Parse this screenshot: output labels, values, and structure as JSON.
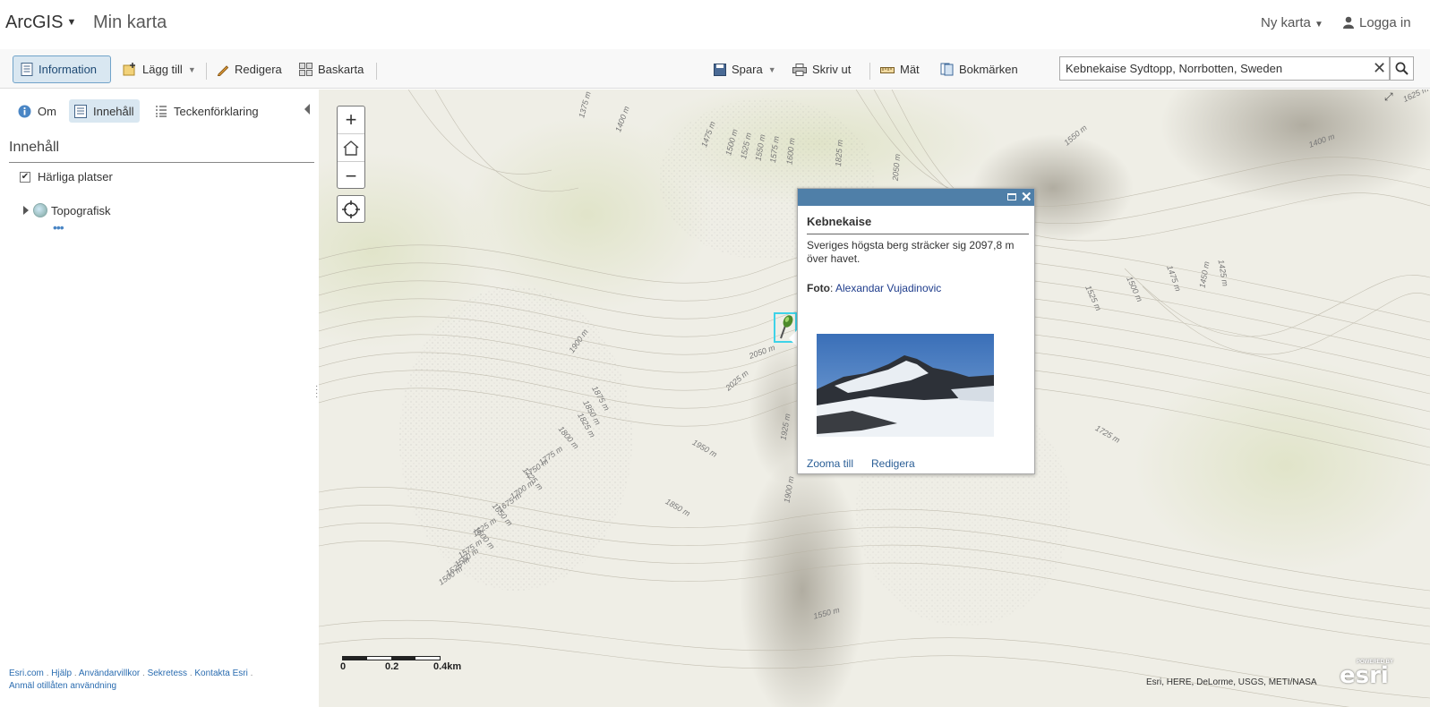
{
  "header": {
    "brand": "ArcGIS",
    "map_title": "Min karta",
    "new_map": "Ny karta",
    "login": "Logga in"
  },
  "toolbar": {
    "info": "Information",
    "add": "Lägg till",
    "edit": "Redigera",
    "basemap": "Baskarta",
    "save": "Spara",
    "print": "Skriv ut",
    "measure": "Mät",
    "bookmarks": "Bokmärken",
    "search_value": "Kebnekaise Sydtopp, Norrbotten, Sweden"
  },
  "panel": {
    "tabs": {
      "about": "Om",
      "content": "Innehåll",
      "legend": "Teckenförklaring"
    },
    "title": "Innehåll",
    "layers": [
      {
        "name": "Härliga platser",
        "checked": true
      },
      {
        "name": "Topografisk"
      }
    ],
    "more": "•••",
    "footer": {
      "esri": "Esri.com",
      "help": "Hjälp",
      "terms": "Användarvillkor",
      "privacy": "Sekretess",
      "contact": "Kontakta Esri",
      "report": "Anmäl otillåten användning"
    }
  },
  "map": {
    "scale": {
      "t0": "0",
      "t1": "0.2",
      "t2": "0.4km"
    },
    "attribution": "Esri, HERE, DeLorme, USGS, METI/NASA",
    "esri_powered": "POWERED BY",
    "esri_logo": "esri",
    "contour_labels": [
      "1375 m",
      "1400 m",
      "1475 m",
      "1500 m",
      "1525 m",
      "1550 m",
      "1575 m",
      "1600 m",
      "1825 m",
      "2050 m",
      "1550 m",
      "1400 m",
      "1625 m",
      "1900 m",
      "2050 m",
      "2025 m",
      "1875 m",
      "1850 m",
      "1825 m",
      "1800 m",
      "1775 m",
      "1750 m",
      "1725 m",
      "1700 m",
      "1675 m",
      "1650 m",
      "1625 m",
      "1600 m",
      "1575 m",
      "1550 m",
      "1525 m",
      "1500 m",
      "1950 m",
      "1925 m",
      "1850 m",
      "1900 m",
      "1550 m",
      "1725 m",
      "1525 m",
      "1500 m",
      "1475 m",
      "1450 m",
      "1425 m"
    ]
  },
  "popup": {
    "title": "Kebnekaise",
    "description": "Sveriges högsta berg sträcker sig 2097,8 m över havet.",
    "foto_label": "Foto",
    "foto_sep": ": ",
    "foto_author": "Alexandar Vujadinovic",
    "zoom": "Zooma till",
    "edit": "Redigera"
  }
}
